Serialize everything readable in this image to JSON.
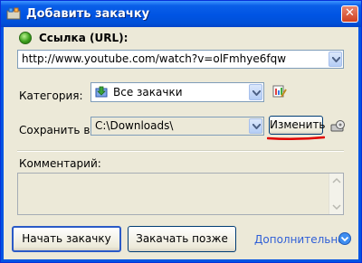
{
  "window": {
    "title": "Добавить закачку",
    "close_label": "✕"
  },
  "url": {
    "label": "Ссылка (URL):",
    "value": "http://www.youtube.com/watch?v=olFmhye6fqw"
  },
  "category": {
    "label": "Категория:",
    "value": "Все закачки"
  },
  "save": {
    "label": "Сохранить в:",
    "value": "C:\\Downloads\\",
    "change_button": "Изменить"
  },
  "comment": {
    "label": "Комментарий:",
    "value": ""
  },
  "buttons": {
    "start": "Начать закачку",
    "later": "Закачать позже",
    "more": "Дополнительно"
  },
  "colors": {
    "titlebar": "#0054e3",
    "annotation_underline": "#e00000",
    "link": "#2f5fd7"
  }
}
